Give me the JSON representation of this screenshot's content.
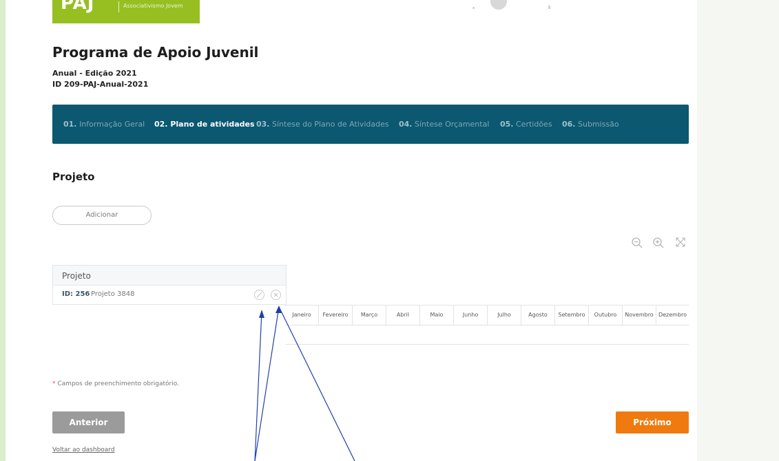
{
  "header": {
    "logo_text": "PAJ",
    "logo_subtitle": "Associativismo Jovem"
  },
  "program": {
    "title": "Programa de Apoio Juvenil",
    "edition": "Anual - Edição 2021",
    "id": "ID 209-PAJ-Anual-2021"
  },
  "steps": [
    {
      "num": "01.",
      "label": "Informação Geral"
    },
    {
      "num": "02.",
      "label": "Plano de atividades",
      "active": true
    },
    {
      "num": "03.",
      "label": "Síntese do Plano de Atividades"
    },
    {
      "num": "04.",
      "label": "Síntese Orçamental"
    },
    {
      "num": "05.",
      "label": "Certidões"
    },
    {
      "num": "06.",
      "label": "Submissão"
    }
  ],
  "section": {
    "title": "Projeto",
    "add_label": "Adicionar"
  },
  "zoom_controls": [
    "zoom-out-icon",
    "zoom-in-icon",
    "fullscreen-icon"
  ],
  "project_panel": {
    "header": "Projeto",
    "row": {
      "id": "ID: 256",
      "name": "Projeto 3848"
    }
  },
  "months": [
    "Janeiro",
    "Fevereiro",
    "Março",
    "Abril",
    "Maio",
    "Junho",
    "Julho",
    "Agosto",
    "Setembro",
    "Outubro",
    "Novembro",
    "Dezembro"
  ],
  "footer": {
    "required_star": "*",
    "required_text": "Campos de preenchimento obrigatório.",
    "prev_label": "Anterior",
    "next_label": "Próximo",
    "back_link": "Voltar ao dashboard"
  },
  "colors": {
    "steps_bg": "#0b5870",
    "logo_bg": "#97bf22",
    "next_button": "#f07a10",
    "prev_button": "#9b9b9b",
    "annotation_arrows": "#1f3fa6"
  }
}
